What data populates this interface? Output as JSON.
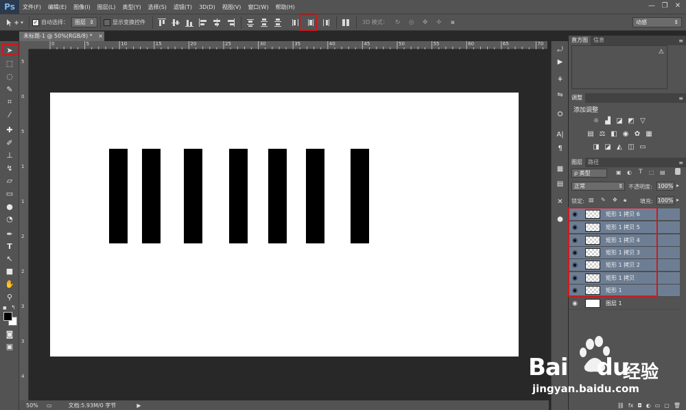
{
  "app": {
    "logo": "Ps"
  },
  "menu": [
    "文件(F)",
    "编辑(E)",
    "图像(I)",
    "图层(L)",
    "类型(Y)",
    "选择(S)",
    "滤镜(T)",
    "3D(D)",
    "视图(V)",
    "窗口(W)",
    "帮助(H)"
  ],
  "window_controls": {
    "minimize": "—",
    "restore": "❐",
    "close": "✕"
  },
  "options": {
    "auto_select_label": "自动选择：",
    "auto_select_checked": true,
    "auto_select_target": "图层",
    "show_transform_label": "显示变换控件",
    "show_transform_checked": false,
    "mode_3d_label": "3D 模式：",
    "workspace": "动感"
  },
  "document": {
    "tab_title": "未标题-1 @ 50%(RGB/8) *",
    "close": "×"
  },
  "ruler": {
    "top_labels": [
      "0",
      "5",
      "10",
      "15",
      "20",
      "25",
      "30",
      "35",
      "40",
      "45",
      "50",
      "55",
      "60",
      "65",
      "70"
    ],
    "left_labels": [
      "5",
      "0",
      "5",
      "1",
      "1",
      "2",
      "2",
      "3",
      "3",
      "4",
      "4"
    ]
  },
  "status": {
    "zoom": "50%",
    "doc_info": "文档:5.93M/0 字节"
  },
  "panels": {
    "histogram_tab": "直方图",
    "info_tab": "信息",
    "adjustments_tab": "调整",
    "adjustments_title": "添加调整",
    "layers_tab": "图层",
    "paths_tab": "路径",
    "kind_filter": "ρ 类型",
    "blend_mode": "正常",
    "opacity_label": "不透明度:",
    "opacity_value": "100%",
    "lock_label": "锁定:",
    "fill_label": "填充:",
    "fill_value": "100%"
  },
  "layers": [
    {
      "name": "矩形 1 拷贝 6",
      "selected": true,
      "type": "shape"
    },
    {
      "name": "矩形 1 拷贝 5",
      "selected": true,
      "type": "shape"
    },
    {
      "name": "矩形 1 拷贝 4",
      "selected": true,
      "type": "shape"
    },
    {
      "name": "矩形 1 拷贝 3",
      "selected": true,
      "type": "shape"
    },
    {
      "name": "矩形 1 拷贝 2",
      "selected": true,
      "type": "shape"
    },
    {
      "name": "矩形 1 拷贝",
      "selected": true,
      "type": "shape"
    },
    {
      "name": "矩形 1",
      "selected": true,
      "type": "shape"
    },
    {
      "name": "图层 1",
      "selected": false,
      "type": "pixel"
    }
  ],
  "watermark": {
    "brand": "Bai",
    "brand2": "du",
    "suffix": "经验",
    "url": "jingyan.baidu.com"
  },
  "colors": {
    "highlight": "#d0181c",
    "selected_layer": "#6d7e94"
  }
}
